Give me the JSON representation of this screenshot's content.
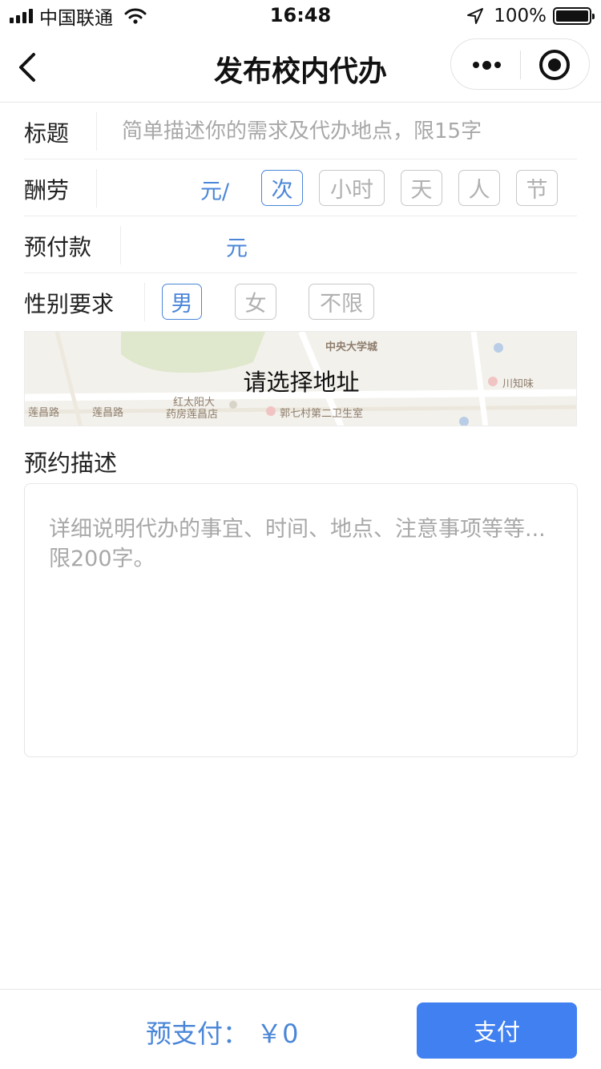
{
  "status_bar": {
    "carrier": "中国联通",
    "time": "16:48",
    "battery": "100%",
    "battery_level": 1.0
  },
  "nav": {
    "title": "发布校内代办",
    "icons": {
      "back": "chevron-left-icon",
      "more": "more-dots-icon",
      "close": "target-circle-icon"
    }
  },
  "form": {
    "title": {
      "label": "标题",
      "placeholder": "简单描述你的需求及代办地点，限15字",
      "value": ""
    },
    "reward": {
      "label": "酬劳",
      "unit": "元/",
      "options": [
        "次",
        "小时",
        "天",
        "人",
        "节"
      ],
      "selected": "次"
    },
    "deposit": {
      "label": "预付款",
      "unit": "元"
    },
    "gender": {
      "label": "性别要求",
      "options": [
        "男",
        "女",
        "不限"
      ],
      "selected": "男"
    }
  },
  "map": {
    "prompt": "请选择地址",
    "labels": [
      "中央大学城",
      "川知味",
      "红太阳大",
      "药房莲昌店",
      "郭七村第二卫生室",
      "莲昌路",
      "莲昌路"
    ]
  },
  "description": {
    "title": "预约描述",
    "placeholder": "详细说明代办的事宜、时间、地点、注意事项等等...限200字。"
  },
  "footer": {
    "prepay": "预支付： ￥0",
    "pay_button": "支付"
  },
  "colors": {
    "accent": "#4a86d8",
    "button": "#4080f0",
    "placeholder": "#a8a8a8",
    "border": "#ececec"
  }
}
